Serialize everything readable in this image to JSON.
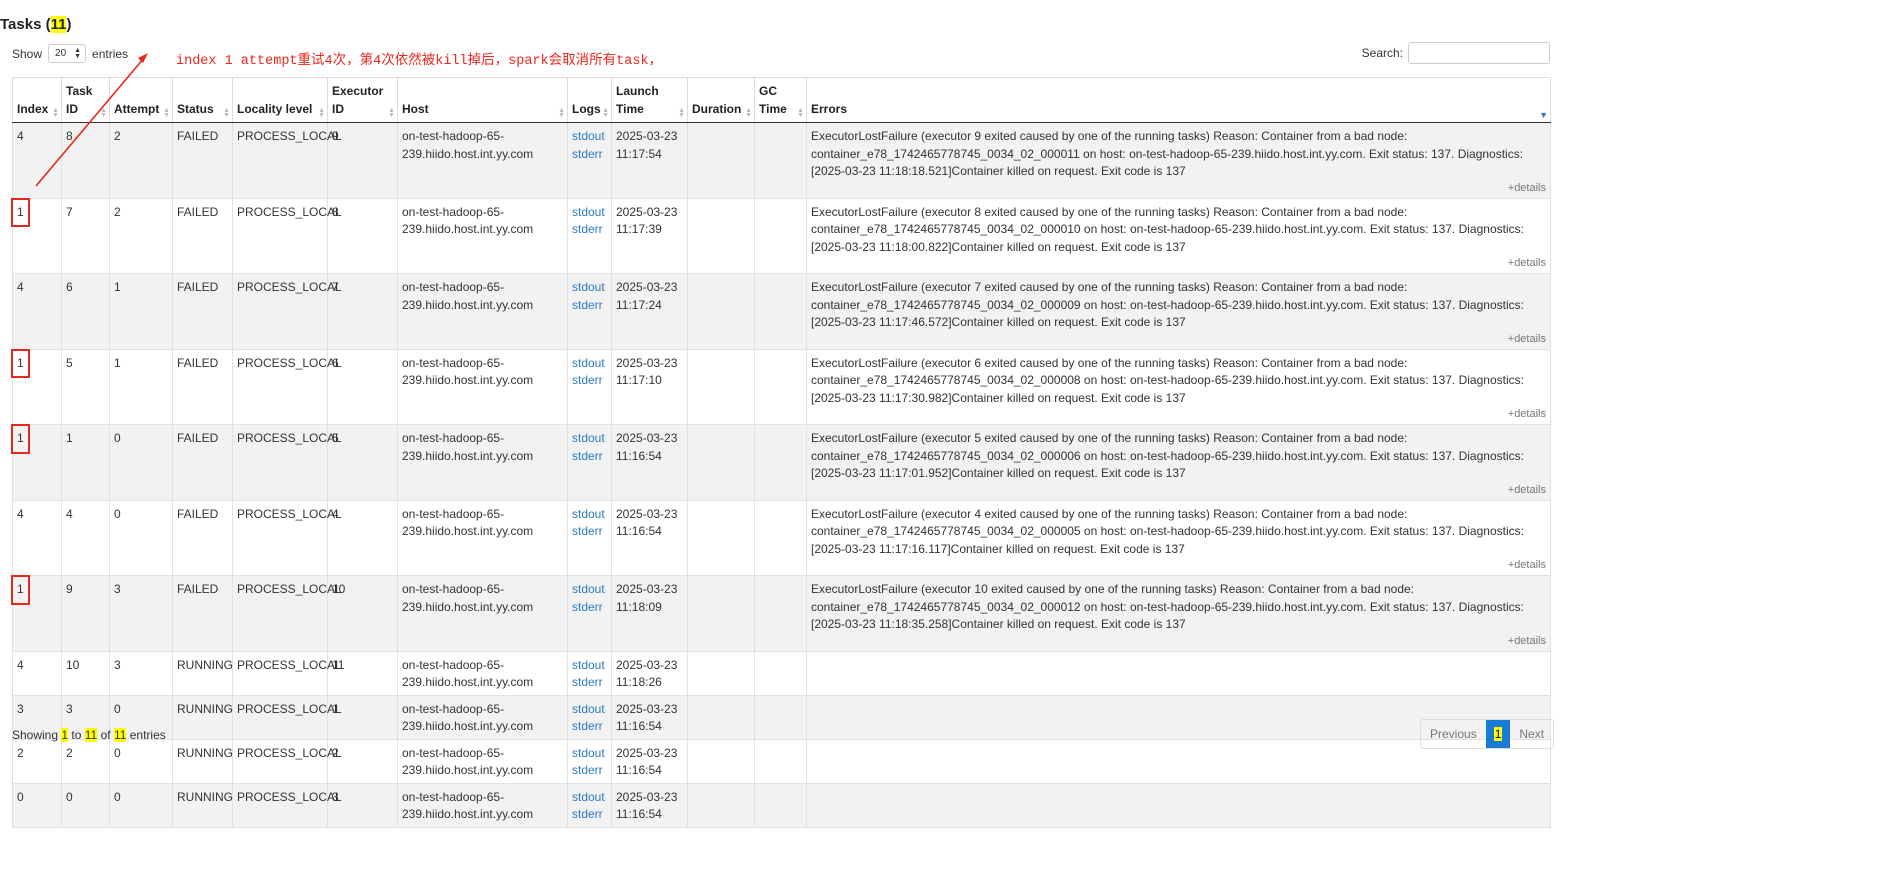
{
  "page": {
    "title_prefix": "Tasks (",
    "title_count": "11",
    "title_suffix": ")"
  },
  "length": {
    "show_label": "Show",
    "value": "20",
    "entries_label": "entries"
  },
  "search": {
    "label": "Search:",
    "value": ""
  },
  "annotation": "index 1 attempt重试4次，第4次依然被kill掉后，spark会取消所有task，",
  "columns": [
    "Index",
    "Task ID",
    "Attempt",
    "Status",
    "Locality level",
    "Executor ID",
    "Host",
    "Logs",
    "Launch Time",
    "Duration",
    "GC Time",
    "Errors"
  ],
  "logs": {
    "stdout": "stdout",
    "stderr": "stderr"
  },
  "details_label": "+details",
  "rows": [
    {
      "index": "4",
      "task_id": "8",
      "attempt": "2",
      "status": "FAILED",
      "locality": "PROCESS_LOCAL",
      "executor": "9",
      "host": "on-test-hadoop-65-239.hiido.host.int.yy.com",
      "launch_date": "2025-03-23",
      "launch_time": "11:17:54",
      "error": "ExecutorLostFailure (executor 9 exited caused by one of the running tasks) Reason: Container from a bad node: container_e78_1742465778745_0034_02_000011 on host: on-test-hadoop-65-239.hiido.host.int.yy.com. Exit status: 137. Diagnostics: [2025-03-23 11:18:18.521]Container killed on request. Exit code is 137"
    },
    {
      "index": "1",
      "task_id": "7",
      "attempt": "2",
      "status": "FAILED",
      "locality": "PROCESS_LOCAL",
      "executor": "8",
      "host": "on-test-hadoop-65-239.hiido.host.int.yy.com",
      "launch_date": "2025-03-23",
      "launch_time": "11:17:39",
      "error": "ExecutorLostFailure (executor 8 exited caused by one of the running tasks) Reason: Container from a bad node: container_e78_1742465778745_0034_02_000010 on host: on-test-hadoop-65-239.hiido.host.int.yy.com. Exit status: 137. Diagnostics: [2025-03-23 11:18:00.822]Container killed on request. Exit code is 137"
    },
    {
      "index": "4",
      "task_id": "6",
      "attempt": "1",
      "status": "FAILED",
      "locality": "PROCESS_LOCAL",
      "executor": "7",
      "host": "on-test-hadoop-65-239.hiido.host.int.yy.com",
      "launch_date": "2025-03-23",
      "launch_time": "11:17:24",
      "error": "ExecutorLostFailure (executor 7 exited caused by one of the running tasks) Reason: Container from a bad node: container_e78_1742465778745_0034_02_000009 on host: on-test-hadoop-65-239.hiido.host.int.yy.com. Exit status: 137. Diagnostics: [2025-03-23 11:17:46.572]Container killed on request. Exit code is 137"
    },
    {
      "index": "1",
      "task_id": "5",
      "attempt": "1",
      "status": "FAILED",
      "locality": "PROCESS_LOCAL",
      "executor": "6",
      "host": "on-test-hadoop-65-239.hiido.host.int.yy.com",
      "launch_date": "2025-03-23",
      "launch_time": "11:17:10",
      "error": "ExecutorLostFailure (executor 6 exited caused by one of the running tasks) Reason: Container from a bad node: container_e78_1742465778745_0034_02_000008 on host: on-test-hadoop-65-239.hiido.host.int.yy.com. Exit status: 137. Diagnostics: [2025-03-23 11:17:30.982]Container killed on request. Exit code is 137"
    },
    {
      "index": "1",
      "task_id": "1",
      "attempt": "0",
      "status": "FAILED",
      "locality": "PROCESS_LOCAL",
      "executor": "5",
      "host": "on-test-hadoop-65-239.hiido.host.int.yy.com",
      "launch_date": "2025-03-23",
      "launch_time": "11:16:54",
      "error": "ExecutorLostFailure (executor 5 exited caused by one of the running tasks) Reason: Container from a bad node: container_e78_1742465778745_0034_02_000006 on host: on-test-hadoop-65-239.hiido.host.int.yy.com. Exit status: 137. Diagnostics: [2025-03-23 11:17:01.952]Container killed on request. Exit code is 137"
    },
    {
      "index": "4",
      "task_id": "4",
      "attempt": "0",
      "status": "FAILED",
      "locality": "PROCESS_LOCAL",
      "executor": "4",
      "host": "on-test-hadoop-65-239.hiido.host.int.yy.com",
      "launch_date": "2025-03-23",
      "launch_time": "11:16:54",
      "error": "ExecutorLostFailure (executor 4 exited caused by one of the running tasks) Reason: Container from a bad node: container_e78_1742465778745_0034_02_000005 on host: on-test-hadoop-65-239.hiido.host.int.yy.com. Exit status: 137. Diagnostics: [2025-03-23 11:17:16.117]Container killed on request. Exit code is 137"
    },
    {
      "index": "1",
      "task_id": "9",
      "attempt": "3",
      "status": "FAILED",
      "locality": "PROCESS_LOCAL",
      "executor": "10",
      "host": "on-test-hadoop-65-239.hiido.host.int.yy.com",
      "launch_date": "2025-03-23",
      "launch_time": "11:18:09",
      "error": "ExecutorLostFailure (executor 10 exited caused by one of the running tasks) Reason: Container from a bad node: container_e78_1742465778745_0034_02_000012 on host: on-test-hadoop-65-239.hiido.host.int.yy.com. Exit status: 137. Diagnostics: [2025-03-23 11:18:35.258]Container killed on request. Exit code is 137"
    },
    {
      "index": "4",
      "task_id": "10",
      "attempt": "3",
      "status": "RUNNING",
      "locality": "PROCESS_LOCAL",
      "executor": "11",
      "host": "on-test-hadoop-65-239.hiido.host.int.yy.com",
      "launch_date": "2025-03-23",
      "launch_time": "11:18:26",
      "error": ""
    },
    {
      "index": "3",
      "task_id": "3",
      "attempt": "0",
      "status": "RUNNING",
      "locality": "PROCESS_LOCAL",
      "executor": "1",
      "host": "on-test-hadoop-65-239.hiido.host.int.yy.com",
      "launch_date": "2025-03-23",
      "launch_time": "11:16:54",
      "error": ""
    },
    {
      "index": "2",
      "task_id": "2",
      "attempt": "0",
      "status": "RUNNING",
      "locality": "PROCESS_LOCAL",
      "executor": "2",
      "host": "on-test-hadoop-65-239.hiido.host.int.yy.com",
      "launch_date": "2025-03-23",
      "launch_time": "11:16:54",
      "error": ""
    },
    {
      "index": "0",
      "task_id": "0",
      "attempt": "0",
      "status": "RUNNING",
      "locality": "PROCESS_LOCAL",
      "executor": "3",
      "host": "on-test-hadoop-65-239.hiido.host.int.yy.com",
      "launch_date": "2025-03-23",
      "launch_time": "11:16:54",
      "error": ""
    }
  ],
  "footer": {
    "showing": "Showing",
    "from": "1",
    "to_label": "to",
    "to": "11",
    "of_label": "of",
    "total": "11",
    "entries": "entries"
  },
  "pager": {
    "previous": "Previous",
    "current": "1",
    "next": "Next"
  },
  "colors": {
    "highlight": "#ffff00",
    "annotation_red": "#e8271c",
    "link": "#2a7bc2",
    "pager_active": "#1a7bd4"
  }
}
